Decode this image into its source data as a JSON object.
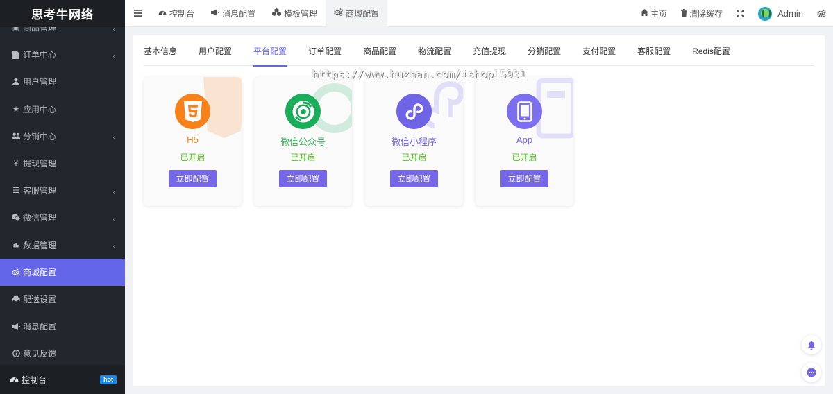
{
  "app": {
    "brand": "思考牛网络"
  },
  "sidebar": {
    "items": [
      {
        "label": "商品管理",
        "icon": "box-icon",
        "has_arrow": true
      },
      {
        "label": "订单中心",
        "icon": "file-icon",
        "has_arrow": true
      },
      {
        "label": "用户管理",
        "icon": "user-icon",
        "has_arrow": false
      },
      {
        "label": "应用中心",
        "icon": "star-icon",
        "has_arrow": false
      },
      {
        "label": "分销中心",
        "icon": "users-icon",
        "has_arrow": true
      },
      {
        "label": "提现管理",
        "icon": "yen-icon",
        "has_arrow": false
      },
      {
        "label": "客服管理",
        "icon": "list-icon",
        "has_arrow": true
      },
      {
        "label": "微信管理",
        "icon": "wechat-icon",
        "has_arrow": true
      },
      {
        "label": "数据管理",
        "icon": "bar-chart-icon",
        "has_arrow": true
      },
      {
        "label": "商城配置",
        "icon": "gears-icon",
        "has_arrow": false,
        "active": true
      },
      {
        "label": "配送设置",
        "icon": "car-icon",
        "has_arrow": false
      },
      {
        "label": "消息配置",
        "icon": "bullhorn-icon",
        "has_arrow": false
      },
      {
        "label": "意见反馈",
        "icon": "question-icon",
        "has_arrow": false
      }
    ],
    "footer": {
      "label": "控制台",
      "badge": "hot",
      "icon": "dashboard-icon"
    }
  },
  "topbar": {
    "tabs": [
      {
        "label": "控制台",
        "icon": "dashboard-icon"
      },
      {
        "label": "消息配置",
        "icon": "bullhorn-icon"
      },
      {
        "label": "模板管理",
        "icon": "cubes-icon"
      },
      {
        "label": "商城配置",
        "icon": "gears-icon",
        "active": true
      }
    ],
    "home_label": "主页",
    "clear_cache_label": "清除缓存",
    "user_name": "Admin"
  },
  "config_tabs": [
    {
      "label": "基本信息"
    },
    {
      "label": "用户配置"
    },
    {
      "label": "平台配置",
      "active": true
    },
    {
      "label": "订单配置"
    },
    {
      "label": "商品配置"
    },
    {
      "label": "物流配置"
    },
    {
      "label": "充值提现"
    },
    {
      "label": "分销配置"
    },
    {
      "label": "支付配置"
    },
    {
      "label": "客服配置"
    },
    {
      "label": "Redis配置"
    }
  ],
  "watermark": "https://www.huzhan.com/ishop15931",
  "platforms": [
    {
      "name": "H5",
      "status": "已开启",
      "button": "立即配置",
      "icon": "html5-icon",
      "color": "#f7821b",
      "name_color": "#f7821b"
    },
    {
      "name": "微信公众号",
      "status": "已开启",
      "button": "立即配置",
      "icon": "wechat-official-icon",
      "color": "#1aad5a",
      "name_color": "#3bb45a"
    },
    {
      "name": "微信小程序",
      "status": "已开启",
      "button": "立即配置",
      "icon": "mini-program-icon",
      "color": "#6f63e6",
      "name_color": "#6f63e6"
    },
    {
      "name": "App",
      "status": "已开启",
      "button": "立即配置",
      "icon": "mobile-icon",
      "color": "#7b6ff0",
      "name_color": "#6f63e6"
    }
  ],
  "colors": {
    "accent": "#6366e8",
    "button": "#7567e8",
    "status_on": "#52c41a",
    "sidebar_bg": "#22272e"
  }
}
